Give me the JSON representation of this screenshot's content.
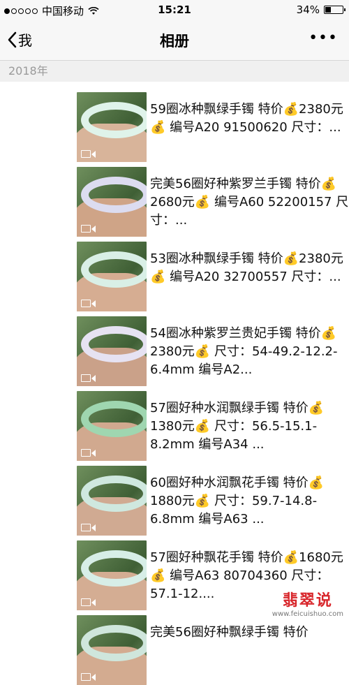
{
  "status_bar": {
    "carrier": "中国移动",
    "signal_filled": 1,
    "signal_total": 5,
    "time": "15:21",
    "battery": "34%",
    "battery_level": 0.34
  },
  "nav": {
    "back_label": "我",
    "title": "相册",
    "more_label": "•••"
  },
  "year": "2018年",
  "items": [
    {
      "caption": "59圈冰种飘绿手镯 特价💰2380元💰 编号A20 91500620 尺寸：...",
      "bangle_color": "#dff3ea",
      "hand_color": "#d8b49a"
    },
    {
      "caption": "完美56圈好种紫罗兰手镯 特价💰2680元💰 编号A60 52200157 尺寸：...",
      "bangle_color": "#dcdcf0",
      "hand_color": "#cfa487"
    },
    {
      "caption": "53圈冰种飘绿手镯 特价💰2380元💰 编号A20 32700557 尺寸：...",
      "bangle_color": "#d9efe6",
      "hand_color": "#d6ad92"
    },
    {
      "caption": "54圈冰种紫罗兰贵妃手镯 特价💰2380元💰 尺寸：54-49.2-12.2-6.4mm 编号A2...",
      "bangle_color": "#e6e2f2",
      "hand_color": "#caa189"
    },
    {
      "caption": "57圈好种水润飘绿手镯 特价💰1380元💰 尺寸：56.5-15.1-8.2mm 编号A34 ...",
      "bangle_color": "#9fd6b0",
      "hand_color": "#d1a98f"
    },
    {
      "caption": "60圈好种水润飘花手镯 特价💰1880元💰 尺寸：59.7-14.8-6.8mm 编号A63 ...",
      "bangle_color": "#cfe8df",
      "hand_color": "#d0aa92"
    },
    {
      "caption": "57圈好种飘花手镯 特价💰1680元💰 编号A63 80704360 尺寸：57.1-12....",
      "bangle_color": "#d7eee7",
      "hand_color": "#d4ad93"
    },
    {
      "caption": "完美56圈好种飘绿手镯 特价",
      "bangle_color": "#cfe6dc",
      "hand_color": "#d3ab90"
    }
  ],
  "watermark": {
    "title": "翡翠说",
    "url": "www.feicuishuo.com"
  }
}
